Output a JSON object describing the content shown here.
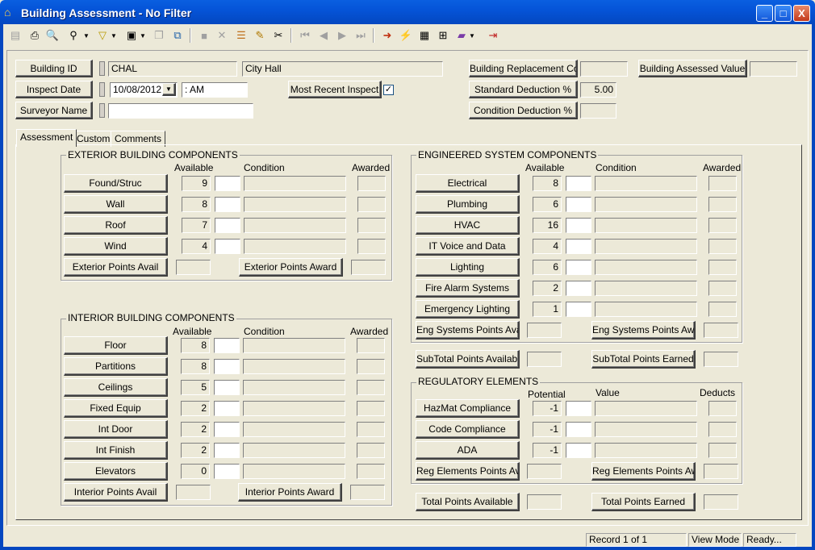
{
  "window": {
    "title": "Building Assessment - No Filter",
    "minimize": "_",
    "maximize": "□",
    "close": "X"
  },
  "toolbar": {
    "icons": [
      "record-icon",
      "print-icon",
      "print-preview-icon",
      "find-icon",
      "filter-icon",
      "report-icon",
      "copy-icon",
      "paste-icon",
      "stop-icon",
      "delete-icon",
      "stack-icon",
      "edit-icon",
      "cut-icon",
      "first-record-icon",
      "prev-record-icon",
      "next-record-icon",
      "last-record-icon",
      "go-icon",
      "lightning-icon",
      "grid-icon",
      "tree-icon",
      "books-icon",
      "exit-icon"
    ]
  },
  "header": {
    "building_id_btn": "Building ID",
    "building_id": "CHAL",
    "building_name": "City Hall",
    "inspect_date_btn": "Inspect Date",
    "inspect_date": "10/08/2012",
    "inspect_time": " :  AM",
    "surveyor_btn": "Surveyor Name",
    "surveyor": "",
    "most_recent_btn": "Most Recent Inspect",
    "most_recent_checked": "✓",
    "replacement_cost_btn": "Building Replacement Cost",
    "replacement_cost": "",
    "assessed_value_btn": "Building Assessed Value",
    "assessed_value": "",
    "std_deduction_btn": "Standard Deduction %",
    "std_deduction": "5.00",
    "cond_deduction_btn": "Condition Deduction %",
    "cond_deduction": ""
  },
  "tabs": [
    "Assessment",
    "Custom",
    "Comments"
  ],
  "exterior": {
    "title": "EXTERIOR BUILDING COMPONENTS",
    "col_available": "Available",
    "col_condition": "Condition",
    "col_awarded": "Awarded",
    "rows": [
      {
        "label": "Found/Struc",
        "available": "9"
      },
      {
        "label": "Wall",
        "available": "8"
      },
      {
        "label": "Roof",
        "available": "7"
      },
      {
        "label": "Wind",
        "available": "4"
      }
    ],
    "points_avail": "Exterior Points Avail",
    "points_award": "Exterior Points Award"
  },
  "interior": {
    "title": "INTERIOR BUILDING COMPONENTS",
    "col_available": "Available",
    "col_condition": "Condition",
    "col_awarded": "Awarded",
    "rows": [
      {
        "label": "Floor",
        "available": "8"
      },
      {
        "label": "Partitions",
        "available": "8"
      },
      {
        "label": "Ceilings",
        "available": "5"
      },
      {
        "label": "Fixed Equip",
        "available": "2"
      },
      {
        "label": "Int Door",
        "available": "2"
      },
      {
        "label": "Int Finish",
        "available": "2"
      },
      {
        "label": "Elevators",
        "available": "0"
      }
    ],
    "points_avail": "Interior Points Avail",
    "points_award": "Interior Points Award"
  },
  "engineered": {
    "title": "ENGINEERED SYSTEM COMPONENTS",
    "col_available": "Available",
    "col_condition": "Condition",
    "col_awarded": "Awarded",
    "rows": [
      {
        "label": "Electrical",
        "available": "8"
      },
      {
        "label": "Plumbing",
        "available": "6"
      },
      {
        "label": "HVAC",
        "available": "16"
      },
      {
        "label": "IT Voice and Data",
        "available": "4"
      },
      {
        "label": "Lighting",
        "available": "6"
      },
      {
        "label": "Fire Alarm Systems",
        "available": "2"
      },
      {
        "label": "Emergency Lighting",
        "available": "1"
      }
    ],
    "points_avail": "Eng Systems Points Avail",
    "points_award": "Eng Systems Points Award"
  },
  "subtotal": {
    "available": "SubTotal Points Available",
    "earned": "SubTotal Points Earned"
  },
  "regulatory": {
    "title": "REGULATORY ELEMENTS",
    "col_potential": "Potential",
    "col_value": "Value",
    "col_deducts": "Deducts",
    "rows": [
      {
        "label": "HazMat Compliance",
        "potential": "-1"
      },
      {
        "label": "Code Compliance",
        "potential": "-1"
      },
      {
        "label": "ADA",
        "potential": "-1"
      }
    ],
    "points_avail": "Reg Elements Points Avail",
    "points_award": "Reg Elements Points Award"
  },
  "total": {
    "available": "Total Points Available",
    "earned": "Total Points Earned"
  },
  "status": {
    "record": "Record 1 of 1",
    "mode": "View Mode",
    "state": "Ready..."
  }
}
